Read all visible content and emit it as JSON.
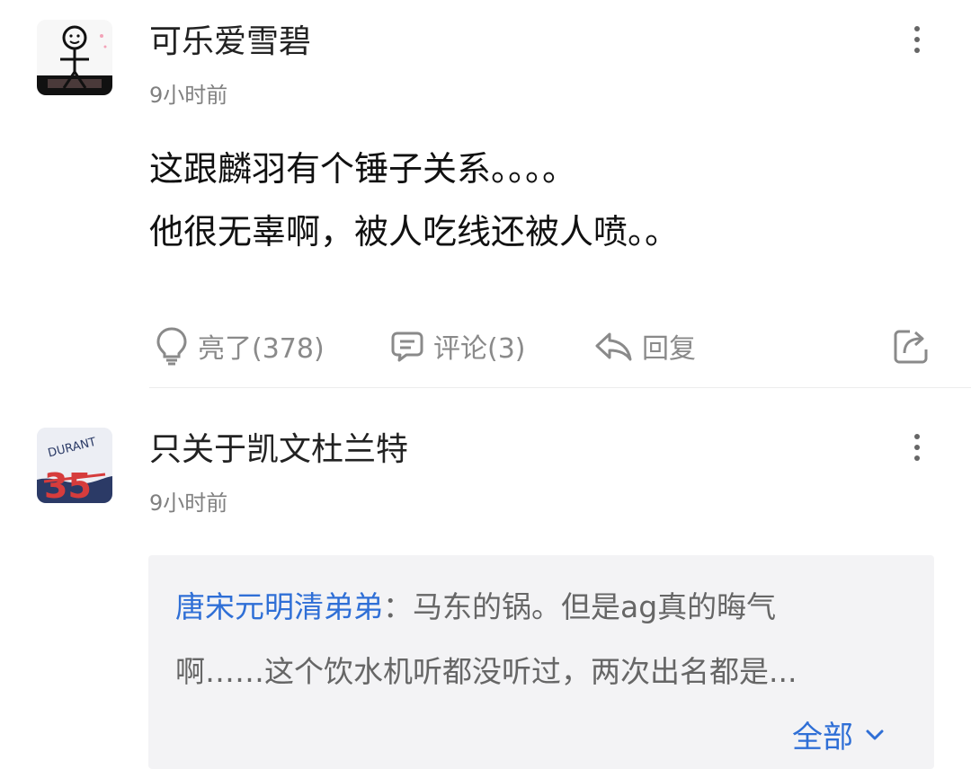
{
  "comments": [
    {
      "username": "可乐爱雪碧",
      "time": "9小时前",
      "content_lines": [
        "这跟麟羽有个锤子关系。。。。",
        "他很无辜啊，被人吃线还被人喷。。"
      ],
      "actions": {
        "like": "亮了(378)",
        "comment": "评论(3)",
        "reply": "回复"
      }
    },
    {
      "username": "只关于凯文杜兰特",
      "time": "9小时前",
      "avatar_text": {
        "name": "DURANT",
        "number": "35"
      },
      "reply_preview": {
        "author": "唐宋元明清弟弟",
        "separator": "：",
        "line1": "马东的锅。但是ag真的晦气",
        "line2": "啊……这个饮水机听都没听过，两次出名都是...",
        "expand": "全部"
      }
    }
  ],
  "colors": {
    "link_blue": "#2f6fd6",
    "muted_gray": "#8a8a8a",
    "reply_bg": "#f3f3f5"
  },
  "icons": {
    "like": "lightbulb-icon",
    "comment": "comment-bubble-icon",
    "reply": "reply-arrow-icon",
    "share": "share-icon",
    "more": "more-vertical-icon",
    "expand": "chevron-down-icon"
  }
}
